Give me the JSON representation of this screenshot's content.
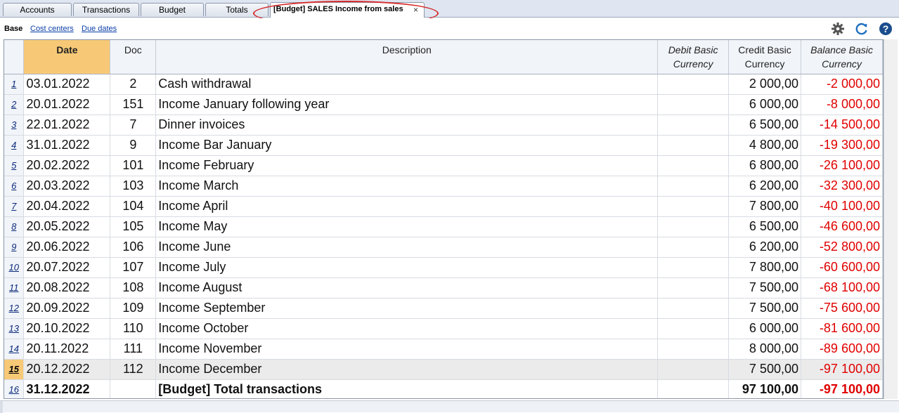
{
  "tabs": [
    {
      "label": "Accounts"
    },
    {
      "label": "Transactions"
    },
    {
      "label": "Budget"
    },
    {
      "label": "Totals"
    },
    {
      "label": "[Budget] SALES Income from sales",
      "close": "×"
    }
  ],
  "views": {
    "base": "Base",
    "cost_centers": "Cost centers",
    "due_dates": "Due dates"
  },
  "toolbar_icons": [
    "gear-icon",
    "refresh-icon",
    "help-icon"
  ],
  "columns": {
    "date": "Date",
    "doc": "Doc",
    "description": "Description",
    "debit_1": "Debit Basic",
    "debit_2": "Currency",
    "credit_1": "Credit Basic",
    "credit_2": "Currency",
    "balance_1": "Balance Basic",
    "balance_2": "Currency"
  },
  "rows": [
    {
      "n": "1",
      "date": "03.01.2022",
      "doc": "2",
      "desc": "Cash withdrawal",
      "debit": "",
      "credit": "2 000,00",
      "balance": "-2 000,00"
    },
    {
      "n": "2",
      "date": "20.01.2022",
      "doc": "151",
      "desc": "Income January following year",
      "debit": "",
      "credit": "6 000,00",
      "balance": "-8 000,00"
    },
    {
      "n": "3",
      "date": "22.01.2022",
      "doc": "7",
      "desc": "Dinner invoices",
      "debit": "",
      "credit": "6 500,00",
      "balance": "-14 500,00"
    },
    {
      "n": "4",
      "date": "31.01.2022",
      "doc": "9",
      "desc": "Income Bar January",
      "debit": "",
      "credit": "4 800,00",
      "balance": "-19 300,00"
    },
    {
      "n": "5",
      "date": "20.02.2022",
      "doc": "101",
      "desc": "Income February",
      "debit": "",
      "credit": "6 800,00",
      "balance": "-26 100,00"
    },
    {
      "n": "6",
      "date": "20.03.2022",
      "doc": "103",
      "desc": "Income March",
      "debit": "",
      "credit": "6 200,00",
      "balance": "-32 300,00"
    },
    {
      "n": "7",
      "date": "20.04.2022",
      "doc": "104",
      "desc": "Income April",
      "debit": "",
      "credit": "7 800,00",
      "balance": "-40 100,00"
    },
    {
      "n": "8",
      "date": "20.05.2022",
      "doc": "105",
      "desc": "Income May",
      "debit": "",
      "credit": "6 500,00",
      "balance": "-46 600,00"
    },
    {
      "n": "9",
      "date": "20.06.2022",
      "doc": "106",
      "desc": "Income June",
      "debit": "",
      "credit": "6 200,00",
      "balance": "-52 800,00"
    },
    {
      "n": "10",
      "date": "20.07.2022",
      "doc": "107",
      "desc": "Income July",
      "debit": "",
      "credit": "7 800,00",
      "balance": "-60 600,00"
    },
    {
      "n": "11",
      "date": "20.08.2022",
      "doc": "108",
      "desc": "Income August",
      "debit": "",
      "credit": "7 500,00",
      "balance": "-68 100,00"
    },
    {
      "n": "12",
      "date": "20.09.2022",
      "doc": "109",
      "desc": "Income September",
      "debit": "",
      "credit": "7 500,00",
      "balance": "-75 600,00"
    },
    {
      "n": "13",
      "date": "20.10.2022",
      "doc": "110",
      "desc": "Income October",
      "debit": "",
      "credit": "6 000,00",
      "balance": "-81 600,00"
    },
    {
      "n": "14",
      "date": "20.11.2022",
      "doc": "111",
      "desc": "Income November",
      "debit": "",
      "credit": "8 000,00",
      "balance": "-89 600,00"
    },
    {
      "n": "15",
      "date": "20.12.2022",
      "doc": "112",
      "desc": "Income December",
      "debit": "",
      "credit": "7 500,00",
      "balance": "-97 100,00",
      "selected": true
    },
    {
      "n": "16",
      "date": "31.12.2022",
      "doc": "",
      "desc": "[Budget] Total transactions",
      "debit": "",
      "credit": "97 100,00",
      "balance": "-97 100,00",
      "total": true
    }
  ],
  "colors": {
    "accent": "#f7c977",
    "negative": "#e00000",
    "link": "#0a3ea8",
    "highlight": "#d62a2a"
  }
}
